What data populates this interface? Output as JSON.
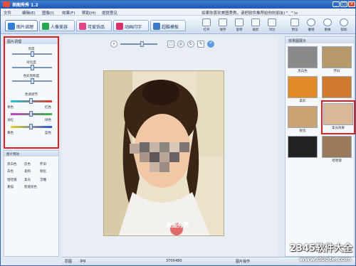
{
  "window": {
    "title": "美图秀秀 1.2",
    "promo": "如果你喜欢美图秀秀，请把软件推荐给你的朋友(^_^)o"
  },
  "menu": [
    "文件",
    "编辑(E)",
    "图像(I)",
    "效果(F)",
    "帮助(H)",
    "提提意见"
  ],
  "tabs": [
    {
      "label": "图片调理",
      "color": "#2f7fd8"
    },
    {
      "label": "人像美容",
      "color": "#27a54f"
    },
    {
      "label": "可爱饰品",
      "color": "#e0458a"
    },
    {
      "label": "动画闪字",
      "color": "#d9306a"
    },
    {
      "label": "超酷模板",
      "color": "#3a78c8"
    }
  ],
  "tools": [
    "打开",
    "保存",
    "旋转",
    "裁剪",
    "对比",
    "预览",
    "撤销",
    "重做",
    "帮助"
  ],
  "adjust": {
    "title": "图片调理",
    "brightness": "亮度",
    "contrast": "对比度",
    "saturation": "色彩饱和度",
    "color_balance": "色调调节",
    "cyan": "青色",
    "red": "红色",
    "magenta": "洋红",
    "green": "绿色",
    "yellow": "黄色",
    "blue": "蓝色"
  },
  "effects": {
    "title": "图片特效",
    "items": [
      "黑白色",
      "反色",
      "怀旧",
      "去色",
      "柔和",
      "锐化",
      "哈哈镜",
      "柔光",
      "浮雕",
      "素描",
      "智能绘色"
    ]
  },
  "thumbs": {
    "title": "效果图展示",
    "items": [
      {
        "label": "黑白色",
        "color": "#8a8a8a"
      },
      {
        "label": "怀旧",
        "color": "#b79a6a"
      },
      {
        "label": "柔彩",
        "color": "#e08a2a"
      },
      {
        "label": "",
        "color": "#cf7a2c"
      },
      {
        "label": "锐化",
        "color": "#c9a374"
      },
      {
        "label": "柔光效果",
        "color": "#d8b896"
      },
      {
        "label": "",
        "color": "#222222"
      },
      {
        "label": "哈哈镜",
        "color": "#9b7a5c"
      }
    ]
  },
  "canvas": {
    "watermark": "美图秀秀"
  },
  "status": {
    "file": "原图",
    "ext": ".jpg",
    "size": "370X480",
    "hint": "图片操作"
  },
  "overlay": {
    "brand": "2345软件大全",
    "url": "www.duote.com"
  }
}
